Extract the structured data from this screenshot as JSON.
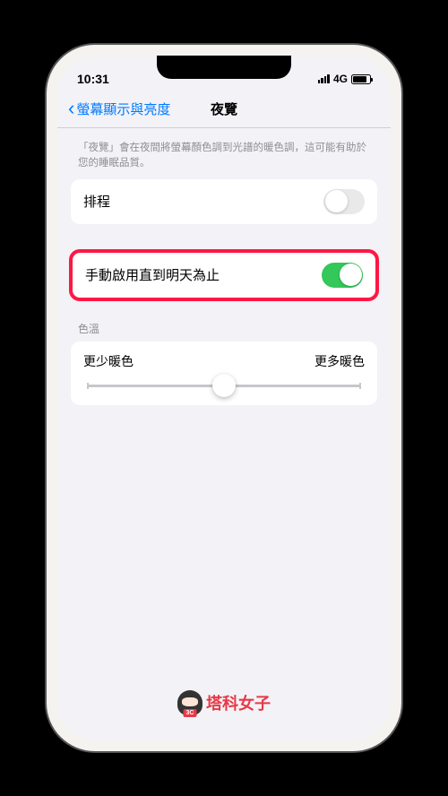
{
  "status_bar": {
    "time": "10:31",
    "network": "4G"
  },
  "nav": {
    "back_label": "螢幕顯示與亮度",
    "title": "夜覽"
  },
  "description": "「夜覽」會在夜間將螢幕顏色調到光譜的暖色調，這可能有助於您的睡眠品質。",
  "schedule": {
    "label": "排程",
    "enabled": false
  },
  "manual": {
    "label": "手動啟用直到明天為止",
    "enabled": true
  },
  "color_temp": {
    "header": "色溫",
    "less_warm": "更少暖色",
    "more_warm": "更多暖色",
    "value": 50
  },
  "watermark": {
    "text": "塔科女子",
    "badge": "3C"
  }
}
